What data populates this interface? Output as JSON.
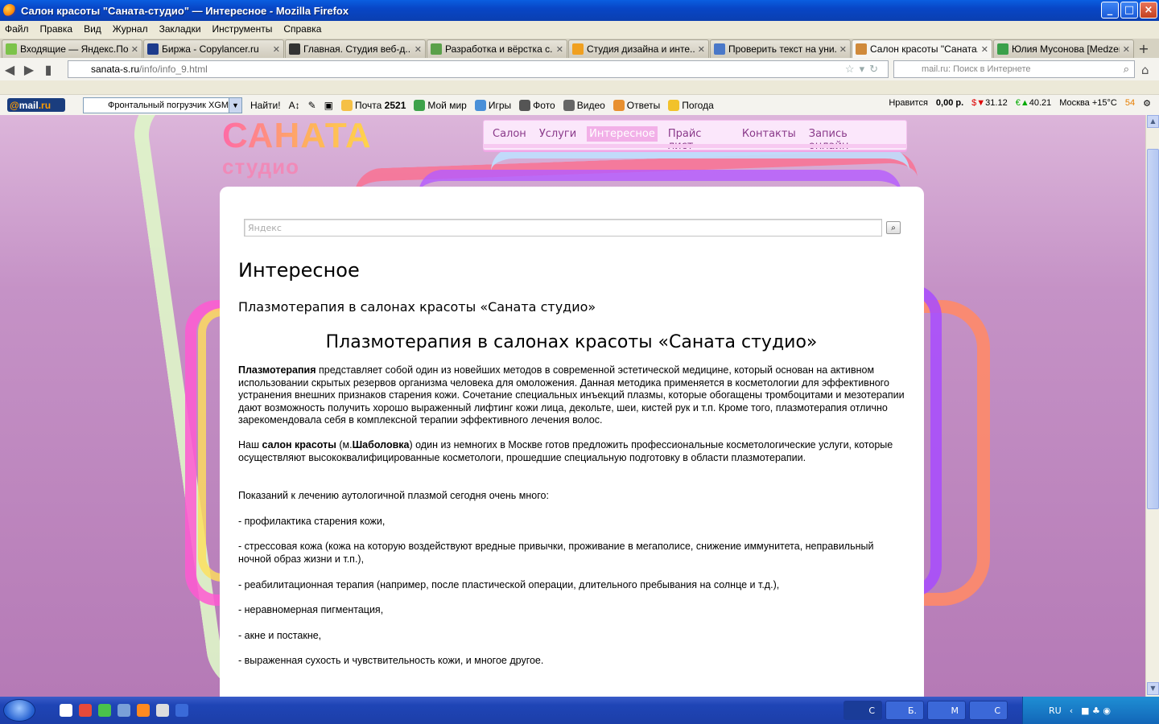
{
  "window": {
    "title": "Салон красоты \"Саната-студио\" — Интересное - Mozilla Firefox",
    "buttons": [
      "_",
      "□",
      "×"
    ]
  },
  "menu": [
    "Файл",
    "Правка",
    "Вид",
    "Журнал",
    "Закладки",
    "Инструменты",
    "Справка"
  ],
  "tabs": [
    {
      "label": "Входящие — Яндекс.По...",
      "color": "#7cc34a"
    },
    {
      "label": "Биржа - Copylancer.ru",
      "color": "#1d3b8c"
    },
    {
      "label": "Главная. Студия веб-д...",
      "color": "#333333"
    },
    {
      "label": "Разработка и вёрстка с...",
      "color": "#5aa04a"
    },
    {
      "label": "Студия дизайна и инте...",
      "color": "#f0a020"
    },
    {
      "label": "Проверить текст на уни...",
      "color": "#4a78c8"
    },
    {
      "label": "Салон красоты \"Саната...",
      "color": "#d08a3a",
      "active": true
    },
    {
      "label": "Юлия Мусонова [Medzen...",
      "color": "#3aa04a"
    }
  ],
  "nav": {
    "url_host": "sanata-s.ru",
    "url_path": "/info/info_9.html",
    "search_placeholder": "mail.ru: Поиск в Интернете"
  },
  "mailbar": {
    "logo_at": "@",
    "logo_mail": "mail",
    "logo_ru": ".ru",
    "search_value": "Фронтальный погрузчик XGM",
    "find": "Найти!",
    "items": [
      {
        "label": "Почта",
        "count": "2521",
        "color": "#f5c046"
      },
      {
        "label": "Мой мир",
        "color": "#3ea24a"
      },
      {
        "label": "Игры",
        "color": "#4a90d8"
      },
      {
        "label": "Фото",
        "color": "#555555"
      },
      {
        "label": "Видео",
        "color": "#666666"
      },
      {
        "label": "Ответы",
        "color": "#e89030"
      },
      {
        "label": "Погода",
        "color": "#f2c22a"
      }
    ],
    "right": {
      "like": "Нравится",
      "balance": "0,00 р.",
      "usd": "31.12",
      "eur": "40.21",
      "weather": "Москва +15°C",
      "traffic": "54"
    }
  },
  "site": {
    "logo_line1": "САНАТА",
    "logo_line2": "студио",
    "nav": [
      "Салон",
      "Услуги",
      "Интересное",
      "Прайс лист",
      "Контакты",
      "Запись онлайн"
    ],
    "nav_active_index": 2,
    "search_placeholder": "Яндекс",
    "page_title": "Интересное",
    "subtitle": "Плазмотерапия в салонах красоты «Саната студио»",
    "article_title": "Плазмотерапия в салонах красоты «Саната студио»",
    "p1_bold": "Плазмотерапия",
    "p1_text": " представляет собой один из новейших методов в современной эстетической медицине, который основан на активном использовании скрытых резервов организма человека для омоложения. Данная методика применяется в косметологии для эффективного устранения внешних признаков старения кожи. Сочетание специальных инъекций плазмы, которые обогащены тромбоцитами и мезотерапии дают возможность получить хорошо выраженный лифтинг кожи лица, декольте, шеи, кистей рук и т.п. Кроме того, плазмотерапия отлично зарекомендовала себя в комплексной терапии эффективного лечения волос.",
    "p2_a": "Наш ",
    "p2_b1": "салон красоты",
    "p2_c": " (м.",
    "p2_b2": "Шаболовка",
    "p2_d": ") один из немногих в Москве готов предложить профессиональные косметологические услуги, которые осуществляют высококвалифицированные косметологи, прошедшие специальную подготовку в области плазмотерапии.",
    "list_intro": "Показаний к лечению аутологичной плазмой сегодня очень много:",
    "list": [
      "- профилактика старения кожи,",
      "- стрессовая кожа (кожа на которую воздействуют вредные привычки, проживание в мегаполисе, снижение иммунитета, неправильный ночной образ жизни и т.п.),",
      "- реабилитационная терапия (например, после пластической операции, длительного пребывания на солнце и т.д.),",
      "- неравномерная пигментация,",
      "- акне и постакне,",
      "- выраженная сухость и чувствительность кожи, и многое другое."
    ]
  },
  "taskbar": {
    "buttons": [
      "С",
      "Б.",
      "М",
      "С"
    ],
    "lang": "RU"
  }
}
